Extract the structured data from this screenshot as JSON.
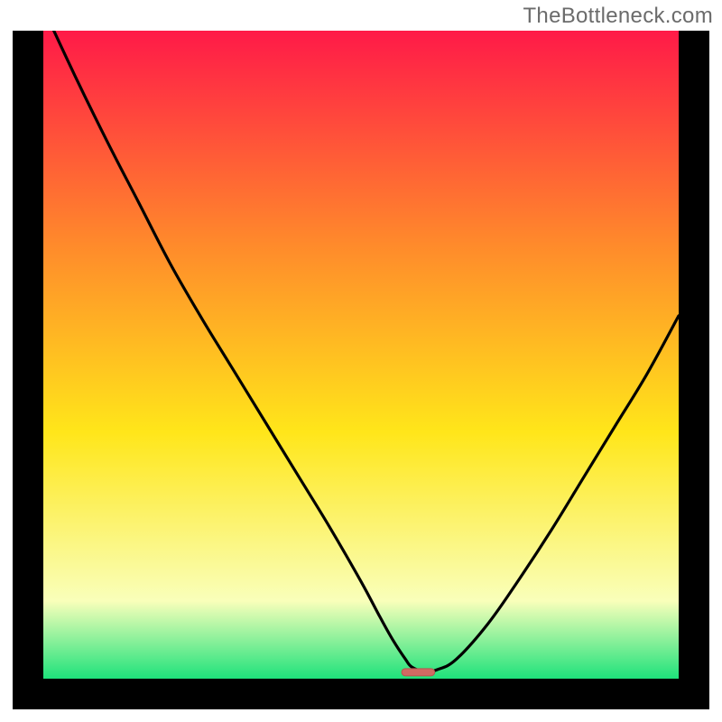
{
  "watermark": "TheBottleneck.com",
  "colors": {
    "gradient_top": "#ff1a48",
    "gradient_upper_mid": "#ff8a2b",
    "gradient_mid": "#ffe61a",
    "gradient_lower": "#f9ffba",
    "gradient_bottom": "#1ee27b",
    "curve": "#000000",
    "marker_fill": "#d06a63",
    "marker_stroke": "#b9564f",
    "frame": "#000000"
  },
  "chart_data": {
    "type": "line",
    "title": "",
    "xlabel": "",
    "ylabel": "",
    "xlim": [
      0,
      100
    ],
    "ylim": [
      0,
      100
    ],
    "x": [
      0,
      5,
      10,
      15,
      20,
      25,
      30,
      35,
      40,
      45,
      50,
      53,
      55,
      57,
      58,
      60,
      62,
      65,
      70,
      75,
      80,
      85,
      90,
      95,
      100
    ],
    "values": [
      103.5,
      93,
      83,
      73.5,
      64,
      55.5,
      47.5,
      39.5,
      31.5,
      23.5,
      15,
      9.5,
      6,
      3,
      1.8,
      1.1,
      1.4,
      3,
      8.5,
      15.5,
      23,
      31,
      39,
      47,
      56
    ],
    "grid": false,
    "legend": false,
    "marker": {
      "x_start": 56.4,
      "x_end": 61.6,
      "y": 1.0,
      "shape": "rounded-bar"
    }
  }
}
